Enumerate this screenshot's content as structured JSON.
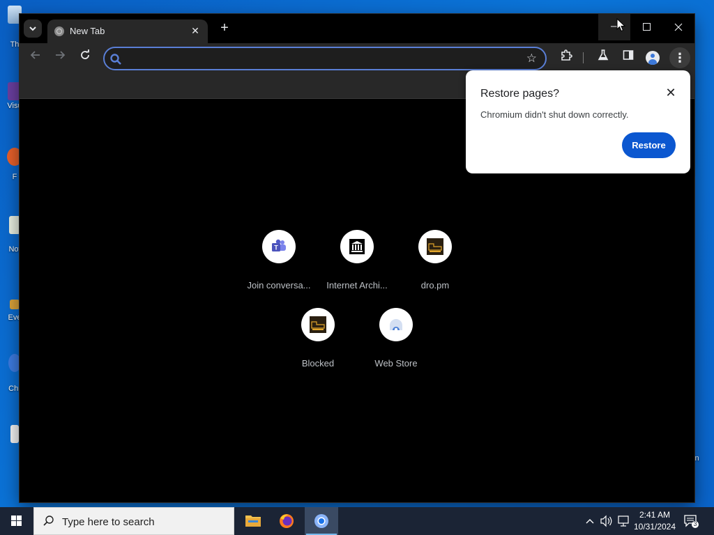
{
  "browser": {
    "tab": {
      "title": "New Tab"
    },
    "omnibox": {
      "value": "",
      "placeholder": ""
    },
    "restore_bubble": {
      "title": "Restore pages?",
      "message": "Chromium didn't shut down correctly.",
      "restore_label": "Restore"
    },
    "shortcuts": [
      {
        "label": "Join conversa...",
        "icon": "teams-icon"
      },
      {
        "label": "Internet Archi...",
        "icon": "internet-archive-icon"
      },
      {
        "label": "dro.pm",
        "icon": "dro-pm-icon"
      },
      {
        "label": "Blocked",
        "icon": "blocked-site-icon"
      },
      {
        "label": "Web Store",
        "icon": "web-store-icon"
      }
    ]
  },
  "desktop": {
    "icons": [
      "Th",
      "Visu",
      "F",
      "Not",
      "Eve",
      "Chr"
    ],
    "right_label": "in"
  },
  "taskbar": {
    "search_placeholder": "Type here to search",
    "time": "2:41 AM",
    "date": "10/31/2024",
    "notification_count": "3"
  },
  "colors": {
    "accent": "#0b57d0",
    "desktop_bg": "#0b74d8",
    "taskbar_bg": "#1b2435"
  }
}
